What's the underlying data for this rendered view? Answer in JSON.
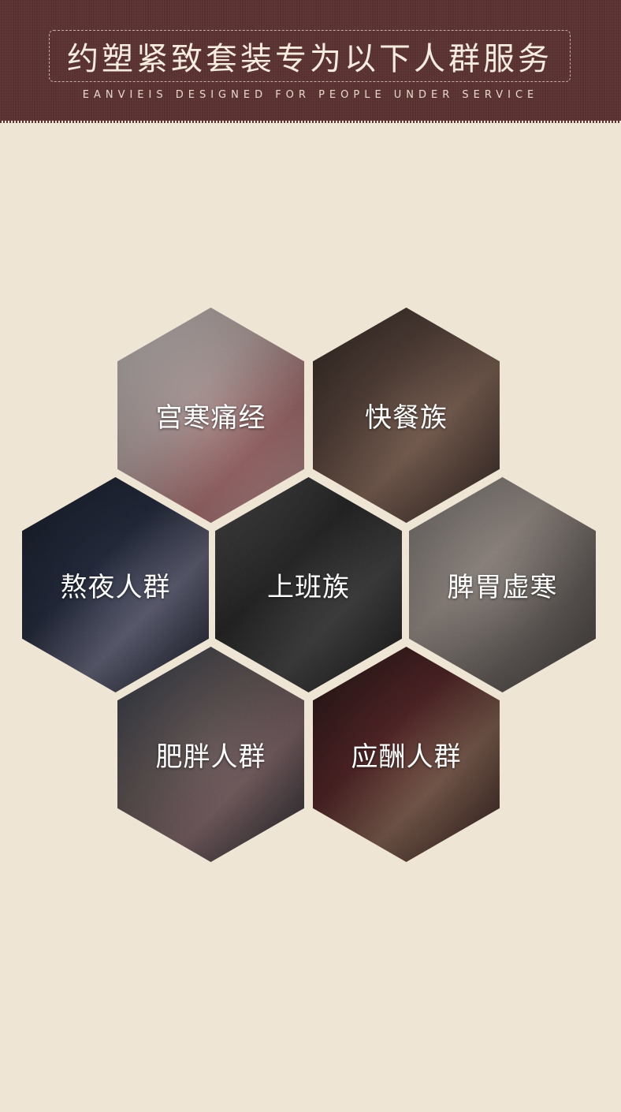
{
  "header": {
    "title": "约塑紧致套装专为以下人群服务",
    "subtitle": "EANVIEIS DESIGNED FOR PEOPLE UNDER SERVICE"
  },
  "groups": [
    {
      "label": "宫寒痛经",
      "image": "woman-with-stomach-pain-photo"
    },
    {
      "label": "快餐族",
      "image": "people-eating-fast-food-photo"
    },
    {
      "label": "熬夜人群",
      "image": "child-using-device-at-night-photo"
    },
    {
      "label": "上班族",
      "image": "office-workers-commuting-photo"
    },
    {
      "label": "脾胃虚寒",
      "image": "tired-person-resting-photo"
    },
    {
      "label": "肥胖人群",
      "image": "overweight-people-sitting-photo"
    },
    {
      "label": "应酬人群",
      "image": "wine-glasses-toast-photo"
    }
  ],
  "colors": {
    "background": "#efe5d4",
    "header": "#5c3232",
    "title_text": "#f5ecdf"
  }
}
